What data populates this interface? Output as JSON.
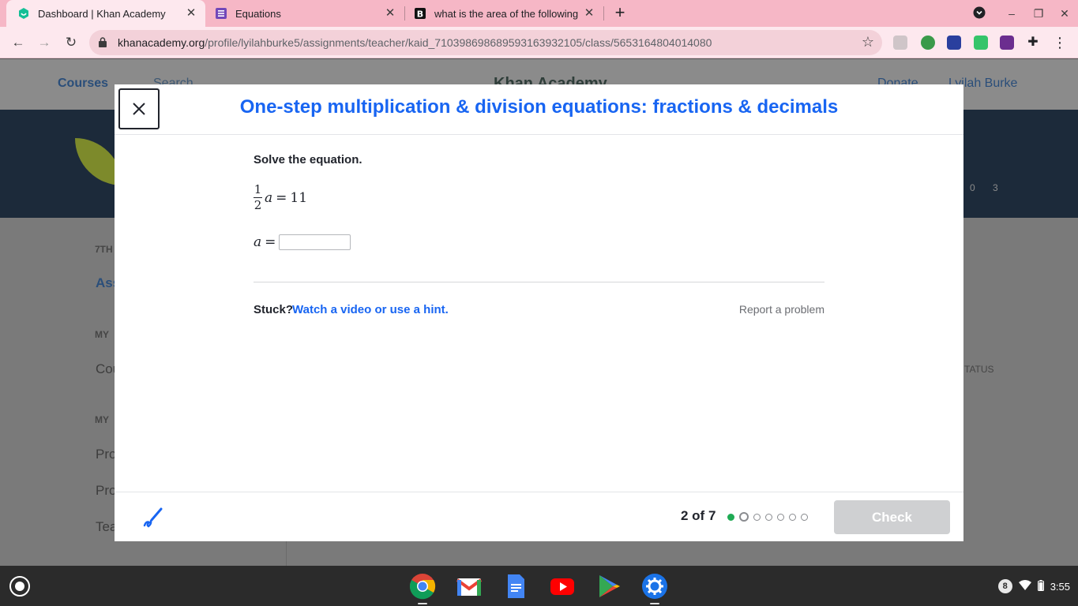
{
  "browser": {
    "tabs": [
      {
        "title": "Dashboard | Khan Academy",
        "favicon": "khan-academy-icon"
      },
      {
        "title": "Equations",
        "favicon": "forms-list-icon"
      },
      {
        "title": "what is the area of the following",
        "favicon": "brainly-icon"
      }
    ],
    "url_host": "khanacademy.org",
    "url_path": "/profile/lyilahburke5/assignments/teacher/kaid_710398698689593163932105/class/5653164804014080"
  },
  "background_page": {
    "nav_courses": "Courses",
    "nav_search": "Search",
    "nav_logo": "Khan Academy",
    "nav_donate": "Donate",
    "nav_user": "Lyilah Burke",
    "stats": "0",
    "stats2": "3",
    "side_7th": "7TH",
    "side_ass": "Ass",
    "side_my": "MY",
    "side_cou": "Cou",
    "side_my2": "MY",
    "side_pro1": "Pro",
    "side_pro2": "Pro",
    "side_tea": "Tea",
    "col_status": "TATUS"
  },
  "modal": {
    "title": "One-step multiplication & division equations: fractions & decimals",
    "prompt": "Solve the equation.",
    "equation": {
      "numerator": "1",
      "denominator": "2",
      "variable": "a",
      "equals": "=",
      "rhs": "11"
    },
    "answer_label": {
      "variable": "a",
      "equals": "="
    },
    "answer_value": "",
    "stuck_label": "Stuck?",
    "hint_link": "Watch a video or use a hint.",
    "report_link": "Report a problem",
    "progress": {
      "current": 2,
      "total": 7,
      "text": "2 of 7"
    },
    "check_label": "Check"
  },
  "colors": {
    "accent": "#1865f2",
    "done": "#1fab54",
    "tabstrip": "#f6b7c6"
  },
  "shelf": {
    "apps": [
      "chrome-icon",
      "gmail-icon",
      "docs-icon",
      "youtube-icon",
      "play-store-icon",
      "settings-icon"
    ],
    "notification_count": "8",
    "time": "3:55"
  }
}
